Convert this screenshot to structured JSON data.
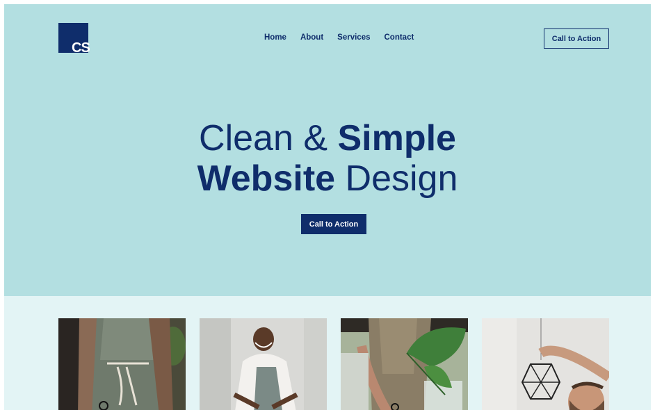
{
  "logo": {
    "text": "CS"
  },
  "nav": {
    "items": [
      "Home",
      "About",
      "Services",
      "Contact"
    ]
  },
  "header": {
    "cta_label": "Call to Action"
  },
  "hero": {
    "line1_light": "Clean & ",
    "line1_bold": "Simple",
    "line2_bold": "Website",
    "line2_light": " Design",
    "cta_label": "Call to Action"
  },
  "colors": {
    "brand": "#0f2d6b",
    "hero_bg": "#b3dfe1",
    "gallery_bg": "#e3f4f5"
  },
  "gallery": {
    "images": [
      "photo-person-apron",
      "photo-smiling-woman",
      "photo-plant-apron",
      "photo-man-lamp"
    ]
  }
}
